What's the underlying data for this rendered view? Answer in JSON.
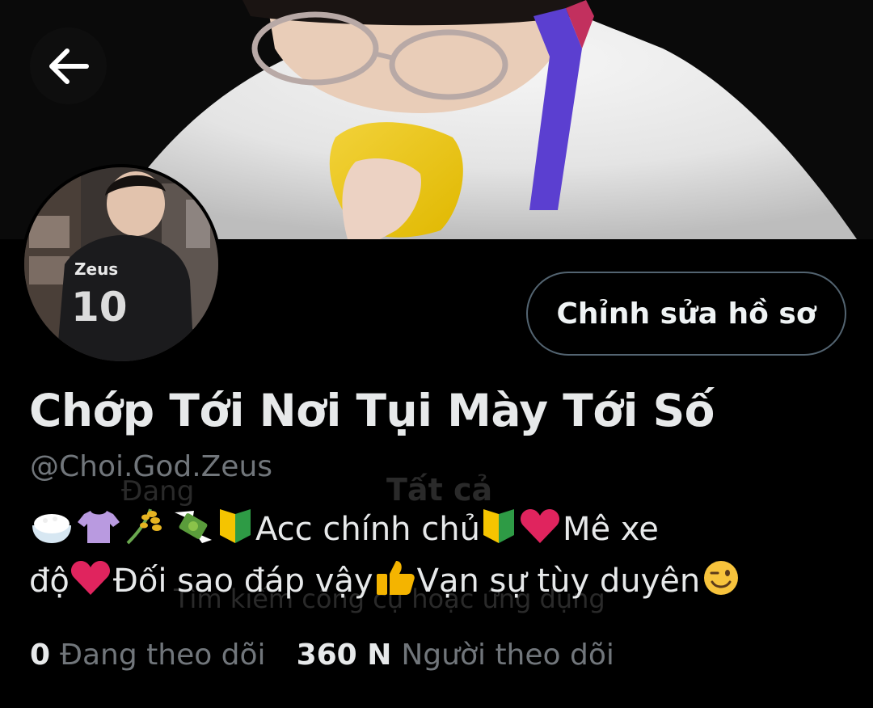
{
  "profile": {
    "display_name": "Chớp Tới Nơi Tụi Mày Tới Số",
    "handle": "@Choi.God.Zeus",
    "edit_button_label": "Chỉnh sửa hồ sơ",
    "avatar_jersey_name": "Zeus",
    "avatar_jersey_number": "10"
  },
  "bio": {
    "emojis_start": [
      "rice-bowl",
      "t-shirt",
      "rice-sheaf",
      "money-with-wings",
      "beginner-symbol"
    ],
    "text_1": "Acc chính chủ",
    "text_2": "Mê xe",
    "text_3": "độ",
    "text_4": "Đối sao đáp vậy",
    "text_5": "Vạn sự tùy duyên"
  },
  "stats": {
    "following_count": "0",
    "following_label": "Đang theo dõi",
    "followers_count": "360 N",
    "followers_label": "Người theo dõi"
  },
  "ghost": {
    "g1": "Đang",
    "g2": "Tất cả",
    "g3": "Tìm kiếm công cụ hoặc ứng dụng"
  },
  "colors": {
    "background": "#000000",
    "primary_text": "#e7e9ea",
    "secondary_text": "#71767b",
    "button_border": "#536471",
    "heart": "#e0245e",
    "beginner_yellow": "#f5c400",
    "beginner_green": "#2e9b45"
  }
}
